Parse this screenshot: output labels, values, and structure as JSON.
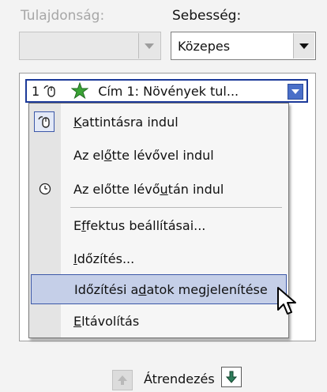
{
  "property": {
    "label": "Tulajdonság:",
    "value": ""
  },
  "speed": {
    "label": "Sebesség:",
    "value": "Közepes"
  },
  "selected_item": {
    "index": "1",
    "text": "Cím 1: Növények tul..."
  },
  "menu": {
    "items": [
      {
        "pre": "",
        "accel": "K",
        "post": "attintásra indul"
      },
      {
        "pre": "Az el",
        "accel": "ő",
        "post": "tte lévővel indul"
      },
      {
        "pre": "Az előtte lévő ",
        "accel": "u",
        "post": "tán indul"
      },
      {
        "pre": "E",
        "accel": "f",
        "post": "fektus beállításai..."
      },
      {
        "pre": "",
        "accel": "I",
        "post": "dőzítés..."
      },
      {
        "pre": "Időzítési a",
        "accel": "d",
        "post": "atok megjelenítése"
      },
      {
        "pre": "",
        "accel": "E",
        "post": "ltávolítás"
      }
    ]
  },
  "reorder": {
    "label": "Átrendezés"
  },
  "icons": {
    "mouse": "mouse-click-icon",
    "effect": "green-star-effect-icon",
    "clock": "clock-icon",
    "up": "move-up-icon",
    "down": "move-down-icon",
    "cursor": "mouse-pointer-icon"
  },
  "colors": {
    "selection_border": "#1c3a99",
    "menu_highlight": "#c5cfe8",
    "down_arrow": "#2e7d5b"
  }
}
